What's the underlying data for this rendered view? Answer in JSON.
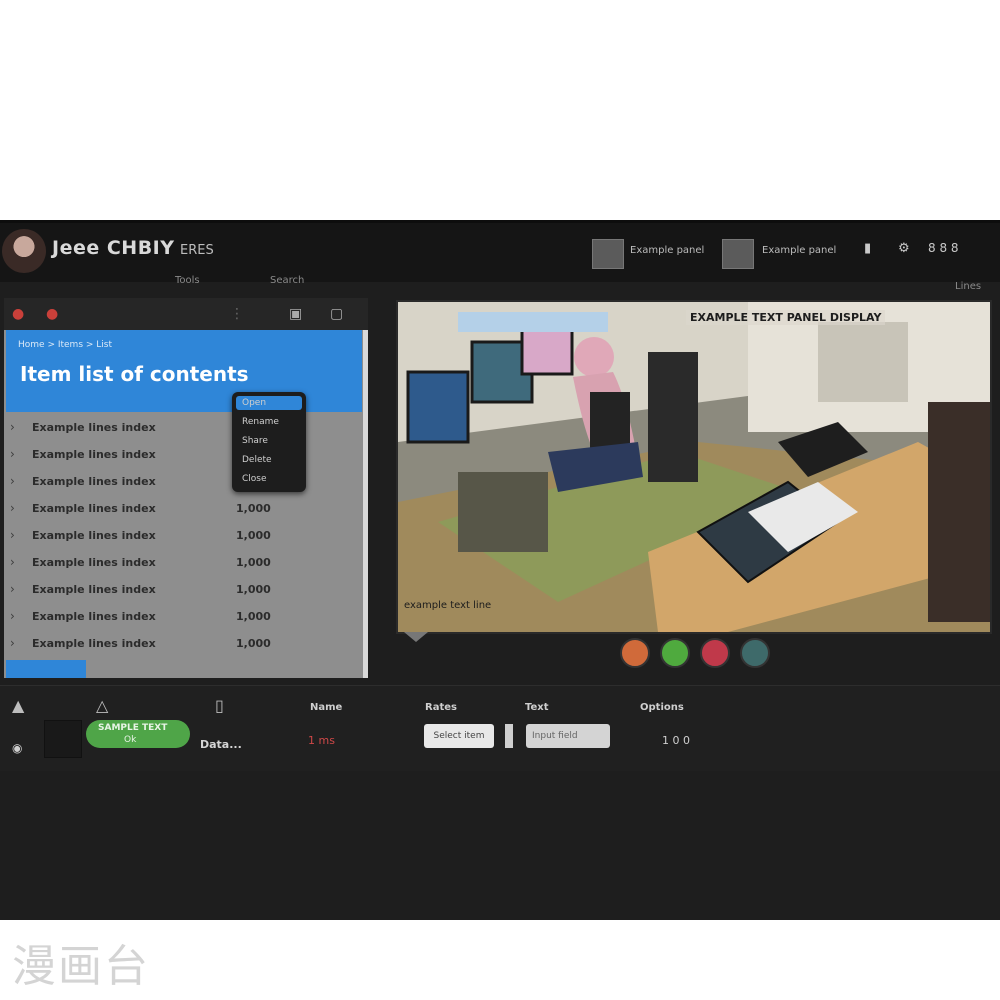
{
  "header": {
    "title": "Jeee CHBIY",
    "subtitle": "ERES",
    "subnav": [
      "Tools",
      "Search"
    ],
    "thumb1_label": "Example panel",
    "thumb2_label": "Example panel",
    "icon1": "lock-icon",
    "icon2": "settings-icon",
    "status": "8 8 8",
    "sub_label": "Lines"
  },
  "left_panel": {
    "breadcrumb": "Home > Items > List",
    "heading": "Item list of contents",
    "dropdown_items": [
      "Open",
      "Rename",
      "Share",
      "Delete",
      "Close"
    ],
    "rows": [
      {
        "name": "Example lines index",
        "value": ""
      },
      {
        "name": "Example lines index",
        "value": ""
      },
      {
        "name": "Example lines index",
        "value": ""
      },
      {
        "name": "Example lines index",
        "value": "1,000"
      },
      {
        "name": "Example lines index",
        "value": "1,000"
      },
      {
        "name": "Example lines index",
        "value": "1,000"
      },
      {
        "name": "Example lines index",
        "value": "1,000"
      },
      {
        "name": "Example lines index",
        "value": "1,000"
      },
      {
        "name": "Example lines index",
        "value": "1,000"
      }
    ]
  },
  "viewport": {
    "hud_top": "EXAMPLE TEXT PANEL DISPLAY",
    "hud_bottom": "example text line"
  },
  "bottom": {
    "headings": [
      "Name",
      "Rates",
      "Text",
      "Options"
    ],
    "pill_line1": "SAMPLE TEXT",
    "pill_line2": "Ok",
    "text": "Data...",
    "red_value": "1 ms",
    "button1": "Select item",
    "button2": "Input field",
    "number": "1 0 0"
  },
  "watermark": "漫画台",
  "colors": {
    "accent_blue": "#2f86d8",
    "green": "#4fa548",
    "orange": "#d06a3a",
    "red": "#c0394a",
    "teal": "#3e6a6a"
  }
}
